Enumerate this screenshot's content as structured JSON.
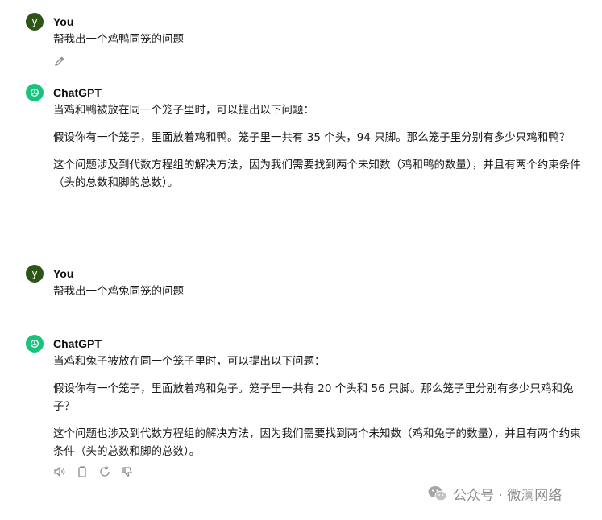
{
  "conversation": [
    {
      "role": "user",
      "avatar_letter": "y",
      "name": "You",
      "paragraphs": [
        "帮我出一个鸡鸭同笼的问题"
      ]
    },
    {
      "role": "assistant",
      "name": "ChatGPT",
      "paragraphs": [
        "当鸡和鸭被放在同一个笼子里时，可以提出以下问题：",
        "假设你有一个笼子，里面放着鸡和鸭。笼子里一共有 35 个头，94 只脚。那么笼子里分别有多少只鸡和鸭？",
        "这个问题涉及到代数方程组的解决方法，因为我们需要找到两个未知数（鸡和鸭的数量），并且有两个约束条件（头的总数和脚的总数）。"
      ]
    },
    {
      "role": "user",
      "avatar_letter": "y",
      "name": "You",
      "paragraphs": [
        "帮我出一个鸡兔同笼的问题"
      ]
    },
    {
      "role": "assistant",
      "name": "ChatGPT",
      "paragraphs": [
        "当鸡和兔子被放在同一个笼子里时，可以提出以下问题：",
        "假设你有一个笼子，里面放着鸡和兔子。笼子里一共有 20 个头和 56 只脚。那么笼子里分别有多少只鸡和兔子？",
        "这个问题也涉及到代数方程组的解决方法，因为我们需要找到两个未知数（鸡和兔子的数量），并且有两个约束条件（头的总数和脚的总数）。"
      ]
    }
  ],
  "watermark": {
    "text": "公众号 · 微澜网络"
  },
  "colors": {
    "user_avatar": "#2e5418",
    "gpt_avatar": "#19c37d",
    "icon": "#8a8a8a"
  }
}
